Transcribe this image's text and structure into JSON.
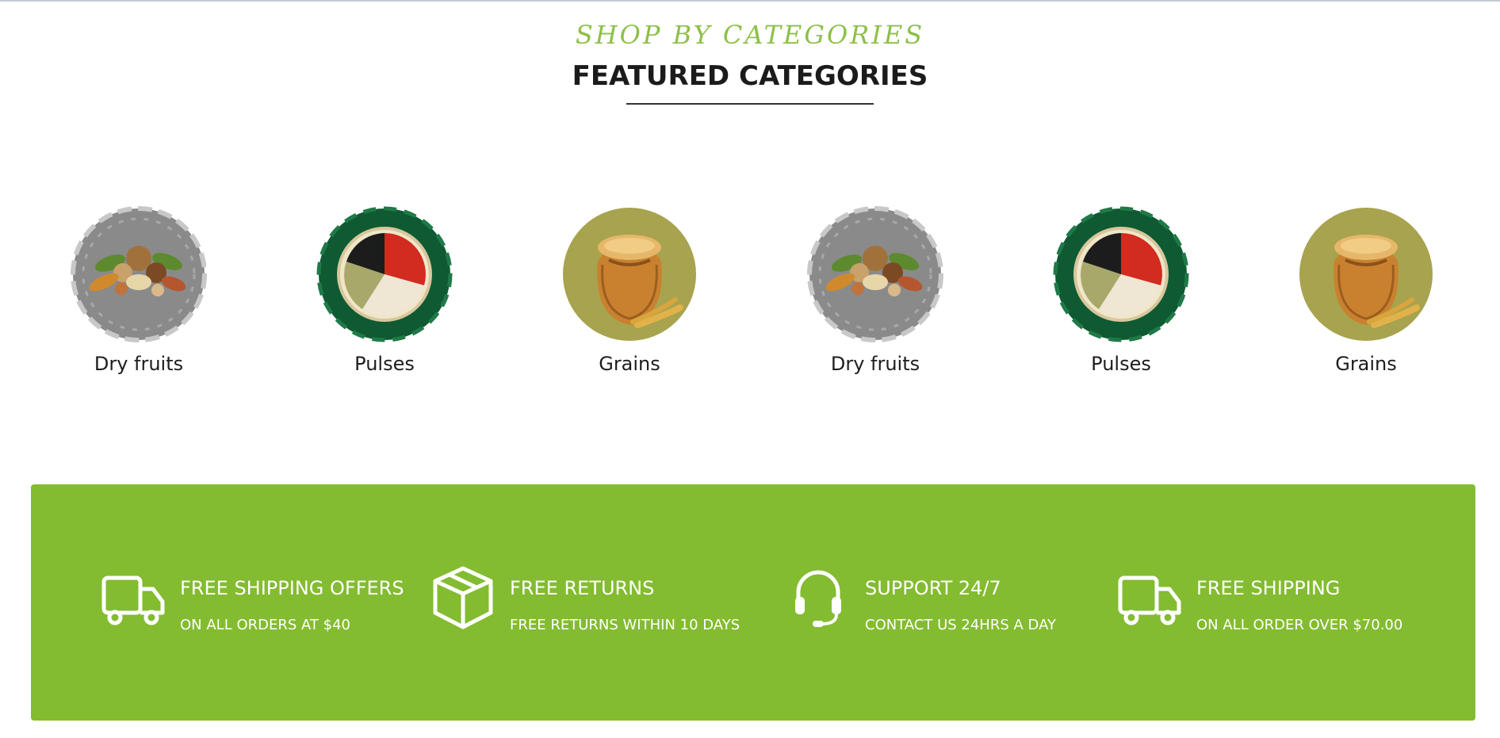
{
  "section": {
    "kicker": "SHOP BY CATEGORIES",
    "title": "FEATURED CATEGORIES"
  },
  "categories": [
    {
      "label": "Dry fruits",
      "icon": "dry-fruits-image"
    },
    {
      "label": "Pulses",
      "icon": "pulses-image"
    },
    {
      "label": "Grains",
      "icon": "grains-sack-image"
    },
    {
      "label": "Dry fruits",
      "icon": "dry-fruits-image"
    },
    {
      "label": "Pulses",
      "icon": "pulses-image"
    },
    {
      "label": "Grains",
      "icon": "grains-sack-image"
    }
  ],
  "features": [
    {
      "title": "FREE SHIPPING OFFERS",
      "subtitle": "ON ALL ORDERS AT $40",
      "icon": "truck-icon"
    },
    {
      "title": "FREE RETURNS",
      "subtitle": "FREE RETURNS WITHIN 10 DAYS",
      "icon": "box-icon"
    },
    {
      "title": "SUPPORT 24/7",
      "subtitle": "CONTACT US 24HRS A DAY",
      "icon": "headset-icon"
    },
    {
      "title": "FREE SHIPPING",
      "subtitle": "ON ALL ORDER OVER $70.00",
      "icon": "truck-icon"
    }
  ],
  "colors": {
    "accent_green": "#83bc30",
    "kicker_green": "#8cc048",
    "dry_fruits_bg": "#8a8a8a",
    "pulses_bg": "#0f5a32",
    "grains_bg": "#a8a34e"
  }
}
